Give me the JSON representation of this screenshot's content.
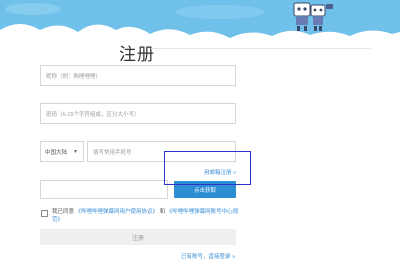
{
  "page": {
    "title": "注册"
  },
  "form": {
    "nickname_placeholder": "昵称（例：购哩哩哩）",
    "password_placeholder": "密码（6-15个字符组成，区分大小写）",
    "country_value": "中国大陆",
    "phone_placeholder": "填写常用手机号",
    "email_register_link": "用邮箱注册 »",
    "code_placeholder": "",
    "get_code_button": "点击获取",
    "agree_prefix": "我已同意",
    "agreement_link_1": "《哔哩哔哩弹幕网用户使用协议》",
    "agree_and": "和",
    "agreement_link_2": "《哔哩哔哩弹幕网账号中心规范》",
    "submit_button": "注册",
    "login_link": "已有账号，直接登录 »"
  },
  "colors": {
    "header_sky": "#6fc1ea",
    "cloud": "#ffffff",
    "accent": "#2e8ed4",
    "link": "#3a8fd8",
    "highlight": "#2a35c9"
  }
}
